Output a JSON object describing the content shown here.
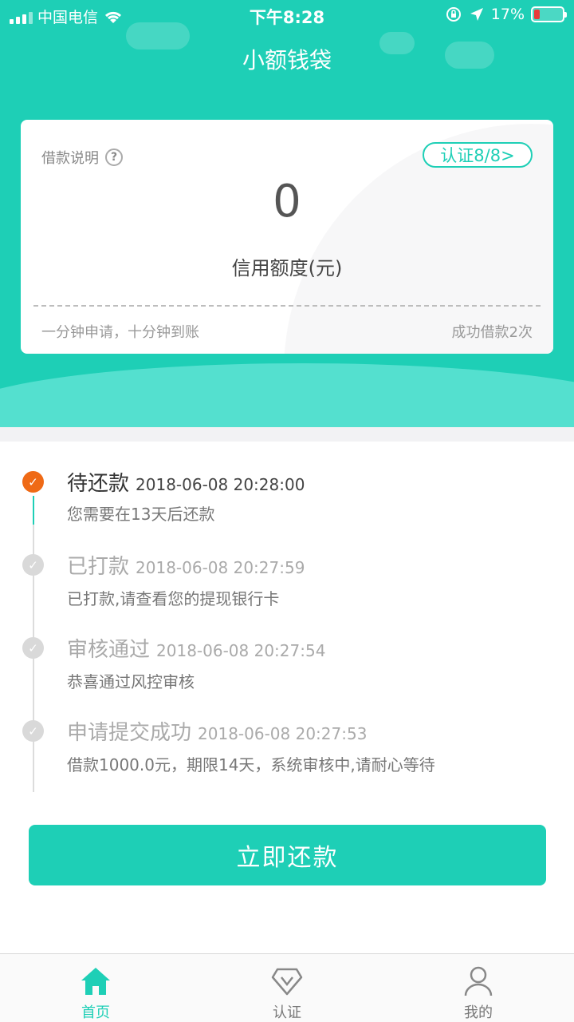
{
  "status_bar": {
    "carrier": "中国电信",
    "time": "下午8:28",
    "battery": "17%"
  },
  "header": {
    "title": "小额钱袋"
  },
  "card": {
    "help_label": "借款说明",
    "help_icon": "?",
    "cert_badge": "认证8/8>",
    "amount": "0",
    "amount_label": "信用额度(元)",
    "footer_left": "一分钟申请，十分钟到账",
    "footer_right": "成功借款2次"
  },
  "timeline": [
    {
      "title": "待还款",
      "time": "2018-06-08 20:28:00",
      "desc": "您需要在13天后还款",
      "status": "active"
    },
    {
      "title": "已打款",
      "time": "2018-06-08 20:27:59",
      "desc": "已打款,请查看您的提现银行卡",
      "status": "done"
    },
    {
      "title": "审核通过",
      "time": "2018-06-08 20:27:54",
      "desc": "恭喜通过风控审核",
      "status": "done"
    },
    {
      "title": "申请提交成功",
      "time": "2018-06-08 20:27:53",
      "desc": "借款1000.0元，期限14天，系统审核中,请耐心等待",
      "status": "done"
    }
  ],
  "repay_button": "立即还款",
  "tabbar": {
    "items": [
      {
        "label": "首页",
        "icon": "home-icon",
        "active": true
      },
      {
        "label": "认证",
        "icon": "certify-icon",
        "active": false
      },
      {
        "label": "我的",
        "icon": "profile-icon",
        "active": false
      }
    ]
  },
  "colors": {
    "accent": "#1ecfb6",
    "active_dot": "#ef6a16",
    "battery_low": "#e8393a"
  }
}
